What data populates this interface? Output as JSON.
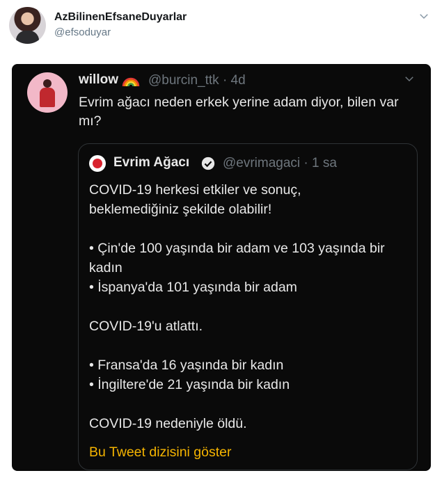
{
  "outer_tweet": {
    "display_name": "AzBilinenEfsaneDuyarlar",
    "handle": "@efsoduyar"
  },
  "screenshot": {
    "tweet": {
      "display_name": "willow",
      "name_emoji": "rainbow-icon",
      "handle_time": "@burcin_ttk · 4d",
      "text": "Evrim ağacı neden erkek yerine adam diyor, bilen var mı?"
    },
    "quoted_tweet": {
      "display_name": "Evrim Ağacı",
      "handle_time": "@evrimagaci · 1 sa",
      "body": "COVID-19 herkesi etkiler ve sonuç,\nbeklemediğiniz şekilde olabilir!\n\n• Çin'de 100 yaşında bir adam ve 103 yaşında bir kadın\n• İspanya'da 101 yaşında bir adam\n\nCOVID-19'u atlattı.\n\n• Fransa'da 16 yaşında bir kadın\n• İngiltere'de 21 yaşında bir kadın\n\nCOVID-19 nedeniyle öldü.",
      "thread_link": "Bu Tweet dizisini göster"
    }
  },
  "colors": {
    "accent_link": "#f5b400",
    "verified": "#e8e8e8",
    "dark_bg": "#0a0a0a"
  }
}
